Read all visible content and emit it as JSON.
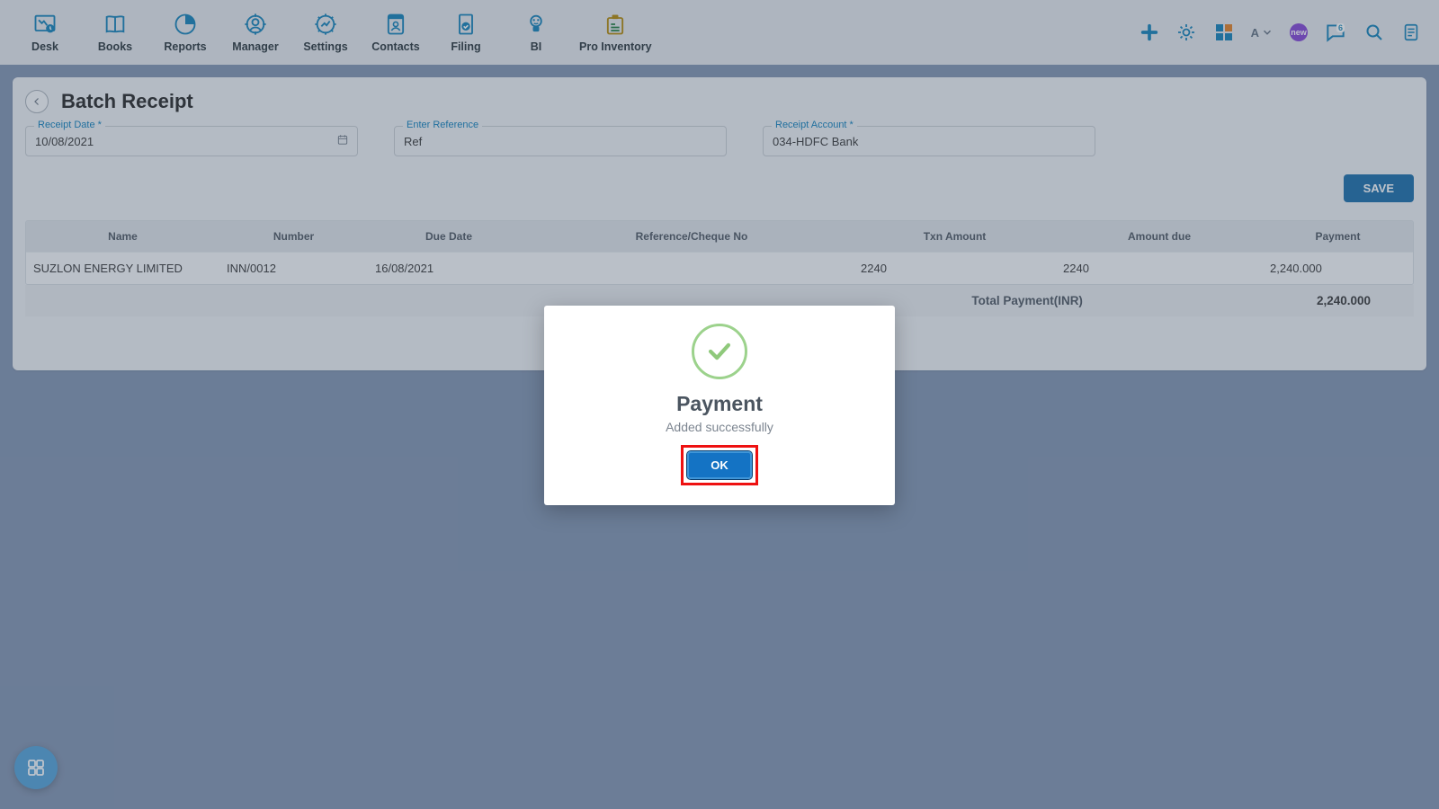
{
  "nav": {
    "items": [
      {
        "label": "Desk"
      },
      {
        "label": "Books"
      },
      {
        "label": "Reports"
      },
      {
        "label": "Manager"
      },
      {
        "label": "Settings"
      },
      {
        "label": "Contacts"
      },
      {
        "label": "Filing"
      },
      {
        "label": "BI"
      },
      {
        "label": "Pro Inventory"
      }
    ],
    "font_letter": "A",
    "new_badge": "new",
    "chat_count": "6"
  },
  "page": {
    "title": "Batch Receipt",
    "receipt_date_label": "Receipt Date *",
    "receipt_date_value": "10/08/2021",
    "reference_label": "Enter Reference",
    "reference_value": "Ref",
    "account_label": "Receipt Account *",
    "account_value": "034-HDFC Bank",
    "save_label": "SAVE"
  },
  "table": {
    "headers": {
      "name": "Name",
      "number": "Number",
      "due": "Due Date",
      "ref": "Reference/Cheque No",
      "txn": "Txn Amount",
      "amd": "Amount due",
      "pay": "Payment"
    },
    "rows": [
      {
        "name": "SUZLON ENERGY LIMITED",
        "number": "INN/0012",
        "due": "16/08/2021",
        "ref": "",
        "txn": "2240",
        "amd": "2240",
        "pay": "2,240.000"
      }
    ],
    "total_label": "Total Payment(INR)",
    "total_value": "2,240.000"
  },
  "dialog": {
    "title": "Payment",
    "message": "Added successfully",
    "ok_label": "OK"
  }
}
